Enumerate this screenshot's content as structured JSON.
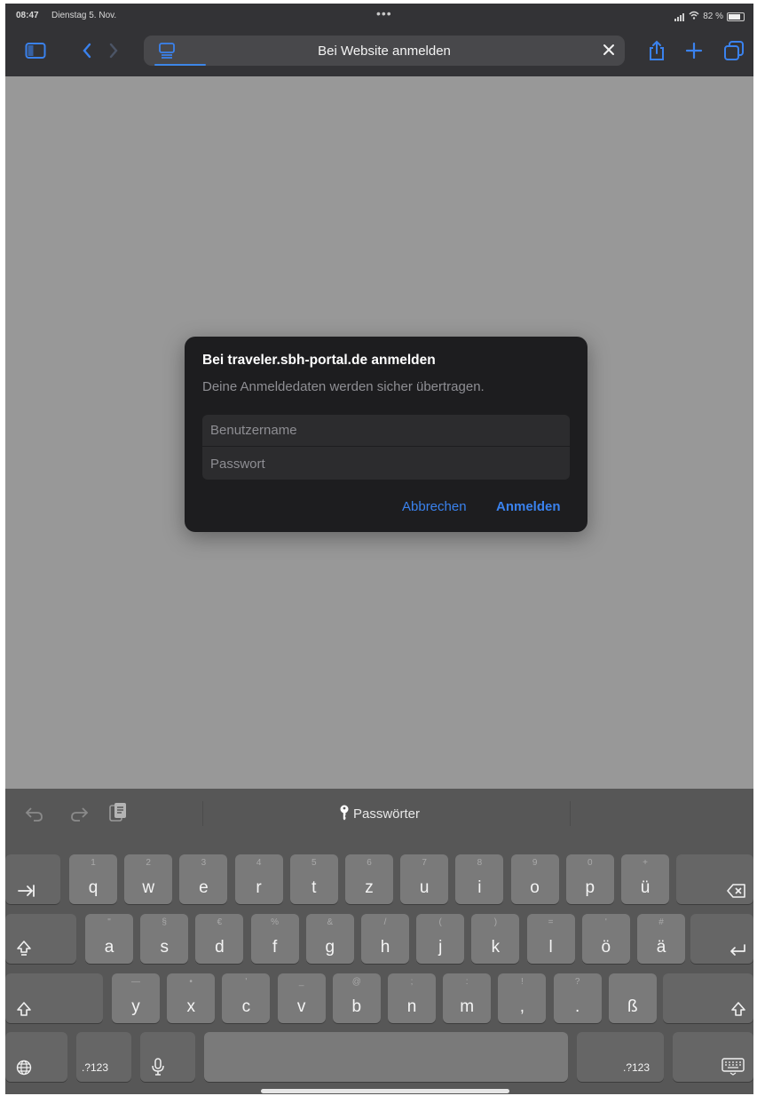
{
  "status_bar": {
    "time": "08:47",
    "date": "Dienstag 5. Nov.",
    "dots": "•••",
    "battery": "82 %"
  },
  "toolbar": {
    "address_title": "Bei Website anmelden"
  },
  "dialog": {
    "title": "Bei traveler.sbh-portal.de anmelden",
    "subtitle": "Deine Anmeldedaten werden sicher übertragen.",
    "username_placeholder": "Benutzername",
    "password_placeholder": "Passwort",
    "cancel_label": "Abbrechen",
    "login_label": "Anmelden"
  },
  "keyboard": {
    "passwords_label": "Passwörter",
    "row1": [
      {
        "main": "q",
        "sub": "1"
      },
      {
        "main": "w",
        "sub": "2"
      },
      {
        "main": "e",
        "sub": "3"
      },
      {
        "main": "r",
        "sub": "4"
      },
      {
        "main": "t",
        "sub": "5"
      },
      {
        "main": "z",
        "sub": "6"
      },
      {
        "main": "u",
        "sub": "7"
      },
      {
        "main": "i",
        "sub": "8"
      },
      {
        "main": "o",
        "sub": "9"
      },
      {
        "main": "p",
        "sub": "0"
      },
      {
        "main": "ü",
        "sub": "+"
      }
    ],
    "row2": [
      {
        "main": "a",
        "sub": "\""
      },
      {
        "main": "s",
        "sub": "§"
      },
      {
        "main": "d",
        "sub": "€"
      },
      {
        "main": "f",
        "sub": "%"
      },
      {
        "main": "g",
        "sub": "&"
      },
      {
        "main": "h",
        "sub": "/"
      },
      {
        "main": "j",
        "sub": "("
      },
      {
        "main": "k",
        "sub": ")"
      },
      {
        "main": "l",
        "sub": "="
      },
      {
        "main": "ö",
        "sub": "'"
      },
      {
        "main": "ä",
        "sub": "#"
      }
    ],
    "row3": [
      {
        "main": "y",
        "sub": "—"
      },
      {
        "main": "x",
        "sub": "•"
      },
      {
        "main": "c",
        "sub": "'"
      },
      {
        "main": "v",
        "sub": "_"
      },
      {
        "main": "b",
        "sub": "@"
      },
      {
        "main": "n",
        "sub": ";"
      },
      {
        "main": "m",
        "sub": ":"
      },
      {
        "main": ",",
        "sub": "!"
      },
      {
        "main": ".",
        "sub": "?"
      },
      {
        "main": "ß",
        "sub": ""
      }
    ],
    "numbers_label": ".?123"
  }
}
